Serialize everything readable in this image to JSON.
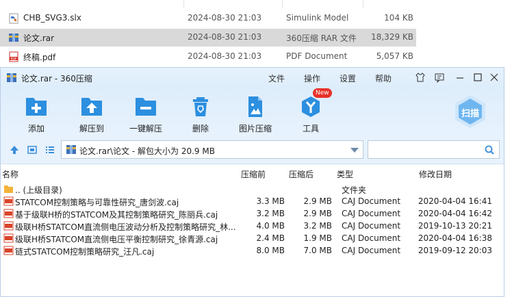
{
  "background_files": [
    {
      "name": "CHB_SVG3.slx",
      "date": "2024-08-30 21:03",
      "type": "Simulink Model",
      "size": "104 KB",
      "icon": "simulink-file-icon",
      "selected": false
    },
    {
      "name": "论文.rar",
      "date": "2024-08-30 21:03",
      "type": "360压缩 RAR 文件",
      "size": "18,329 KB",
      "icon": "rar-file-icon",
      "selected": true
    },
    {
      "name": "终稿.pdf",
      "date": "2024-08-30 21:03",
      "type": "PDF Document",
      "size": "5,057 KB",
      "icon": "pdf-file-icon",
      "selected": false
    }
  ],
  "window": {
    "title": "论文.rar - 360压缩",
    "menu": [
      "文件",
      "操作",
      "设置",
      "帮助"
    ]
  },
  "toolbar": {
    "items": [
      {
        "label": "添加",
        "icon": "add-icon"
      },
      {
        "label": "解压到",
        "icon": "extract-to-icon"
      },
      {
        "label": "一键解压",
        "icon": "one-click-extract-icon"
      },
      {
        "label": "删除",
        "icon": "delete-icon"
      },
      {
        "label": "图片压缩",
        "icon": "image-compress-icon"
      },
      {
        "label": "工具",
        "icon": "tools-icon"
      }
    ],
    "new_badge": "New",
    "scan_label": "扫描"
  },
  "address": {
    "path": "论文.rar\\论文 - 解包大小为 20.9 MB",
    "search_placeholder": ""
  },
  "columns": [
    "名称",
    "压缩前",
    "压缩后",
    "类型",
    "修改日期"
  ],
  "parent_row": {
    "name": ".. (上级目录)",
    "type": "文件夹"
  },
  "files": [
    {
      "name": "STATCOM控制策略与可靠性研究_唐剑波.caj",
      "before": "3.3 MB",
      "after": "2.9 MB",
      "type": "CAJ Document",
      "date": "2020-04-04 16:41"
    },
    {
      "name": "基于级联H桥的STATCOM及其控制策略研究_陈丽兵.caj",
      "before": "3.2 MB",
      "after": "2.9 MB",
      "type": "CAJ Document",
      "date": "2020-04-04 16:42"
    },
    {
      "name": "级联H桥STATCOM直流侧电压波动分析及控制策略研究_林...",
      "before": "4.0 MB",
      "after": "3.2 MB",
      "type": "CAJ Document",
      "date": "2019-10-13 20:21"
    },
    {
      "name": "级联H桥STATCOM直流侧电压平衡控制研究_徐青源.caj",
      "before": "2.4 MB",
      "after": "1.9 MB",
      "type": "CAJ Document",
      "date": "2020-04-04 16:38"
    },
    {
      "name": "链式STATCOM控制策略研究_汪凡.caj",
      "before": "8.0 MB",
      "after": "7.0 MB",
      "type": "CAJ Document",
      "date": "2019-09-12 20:03"
    }
  ],
  "colors": {
    "accent": "#2c8fe0",
    "selection": "#d9d9d9",
    "caj": "#d9442a",
    "folder": "#f3b23a"
  }
}
